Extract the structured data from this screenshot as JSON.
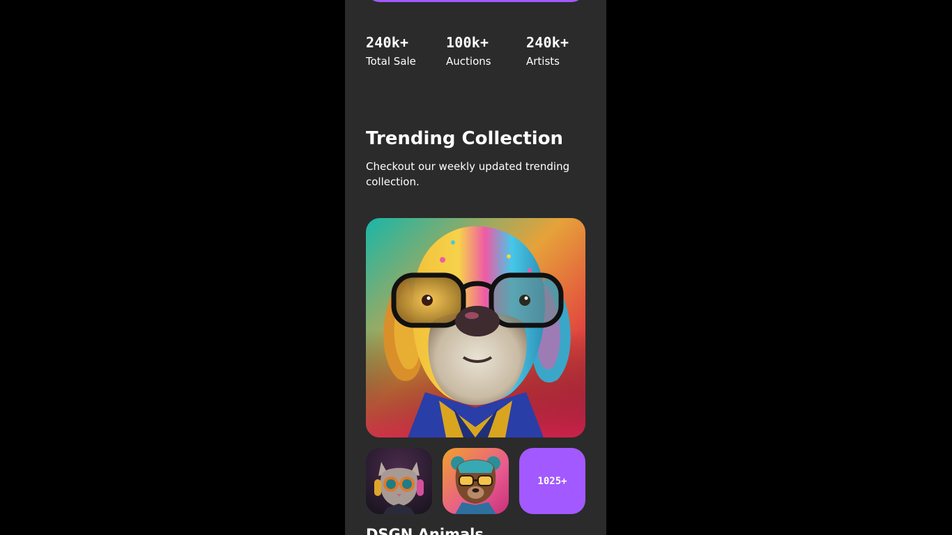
{
  "colors": {
    "page_background": "#000000",
    "panel_background": "#2b2b2b",
    "accent": "#a259ff",
    "text": "#ffffff"
  },
  "stats": [
    {
      "value": "240k+",
      "label": "Total Sale"
    },
    {
      "value": "100k+",
      "label": "Auctions"
    },
    {
      "value": "240k+",
      "label": "Artists"
    }
  ],
  "trending": {
    "title": "Trending Collection",
    "subtitle": "Checkout our weekly updated trending collection.",
    "hero_image": "colorful-dog-with-glasses",
    "thumbnails": [
      "cat-with-goggles-headphones",
      "bear-with-sunglasses"
    ],
    "more_count": "1025+",
    "collection_name": "DSGN Animals"
  }
}
